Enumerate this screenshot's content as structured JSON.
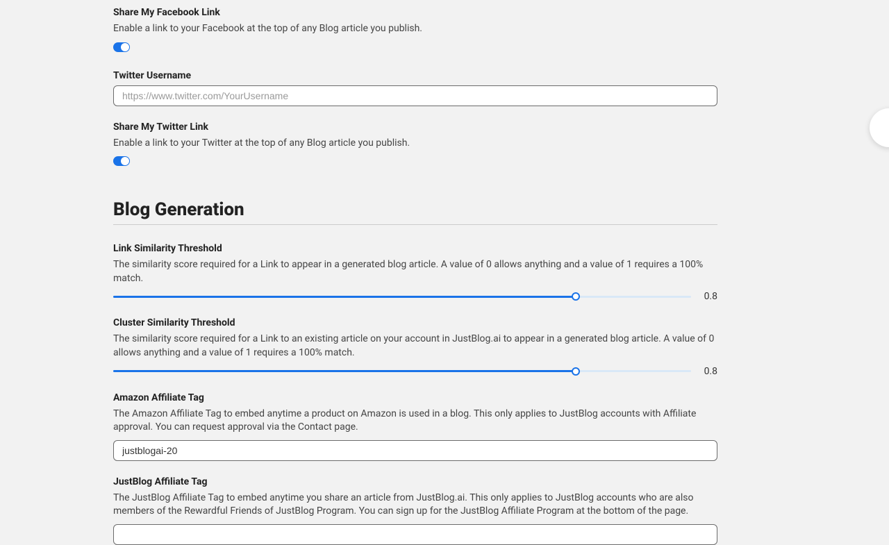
{
  "facebook": {
    "share_label": "Share My Facebook Link",
    "share_desc": "Enable a link to your Facebook at the top of any Blog article you publish."
  },
  "twitter": {
    "username_label": "Twitter Username",
    "placeholder": "https://www.twitter.com/YourUsername",
    "share_label": "Share My Twitter Link",
    "share_desc": "Enable a link to your Twitter at the top of any Blog article you publish."
  },
  "section": {
    "title": "Blog Generation"
  },
  "link_threshold": {
    "label": "Link Similarity Threshold",
    "desc": "The similarity score required for a Link to appear in a generated blog article. A value of 0 allows anything and a value of 1 requires a 100% match.",
    "value": "0.8",
    "pct": 80
  },
  "cluster_threshold": {
    "label": "Cluster Similarity Threshold",
    "desc": "The similarity score required for a Link to an existing article on your account in JustBlog.ai to appear in a generated blog article. A value of 0 allows anything and a value of 1 requires a 100% match.",
    "value": "0.8",
    "pct": 80
  },
  "amazon": {
    "label": "Amazon Affiliate Tag",
    "desc": "The Amazon Affiliate Tag to embed anytime a product on Amazon is used in a blog. This only applies to JustBlog accounts with Affiliate approval. You can request approval via the Contact page.",
    "value": "justblogai-20"
  },
  "justblog": {
    "label": "JustBlog Affiliate Tag",
    "desc": "The JustBlog Affiliate Tag to embed anytime you share an article from JustBlog.ai. This only applies to JustBlog accounts who are also members of the Rewardful Friends of JustBlog Program. You can sign up for the JustBlog Affiliate Program at the bottom of the page."
  }
}
